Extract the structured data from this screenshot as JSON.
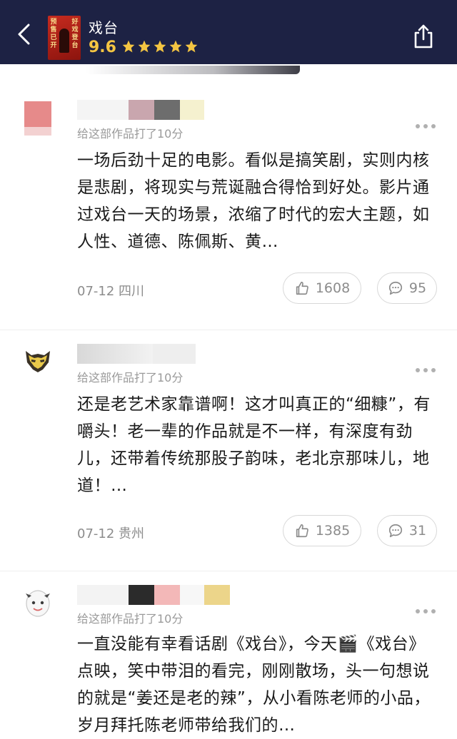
{
  "header": {
    "title": "戏台",
    "score": "9.6",
    "stars": 5,
    "poster_text_left": "预售已开",
    "poster_text_right": "好戏登台",
    "background": "#1d2244",
    "star_color": "#f4c542"
  },
  "comments": [
    {
      "rating_text": "给这部作品打了10分",
      "text": "一场后劲十足的电影。看似是搞笑剧，实则内核是悲剧，将现实与荒诞融合得恰到好处。影片通过戏台一天的场景，浓缩了时代的宏大主题，如人性、道德、陈佩斯、黄…",
      "date": "07-12",
      "location": "四川",
      "likes": "1608",
      "replies": "95"
    },
    {
      "rating_text": "给这部作品打了10分",
      "text": "还是老艺术家靠谱啊！这才叫真正的“细糠”，有嚼头！老一辈的作品就是不一样，有深度有劲儿，还带着传统那股子韵味，老北京那味儿，地道！…",
      "date": "07-12",
      "location": "贵州",
      "likes": "1385",
      "replies": "31"
    },
    {
      "rating_text": "给这部作品打了10分",
      "text": "一直没能有幸看话剧《戏台》，今天🎬《戏台》点映，笑中带泪的看完，刚刚散场，头一句想说的就是“姜还是老的辣”，从小看陈老师的小品，岁月拜托陈老师带给我们的…"
    }
  ]
}
